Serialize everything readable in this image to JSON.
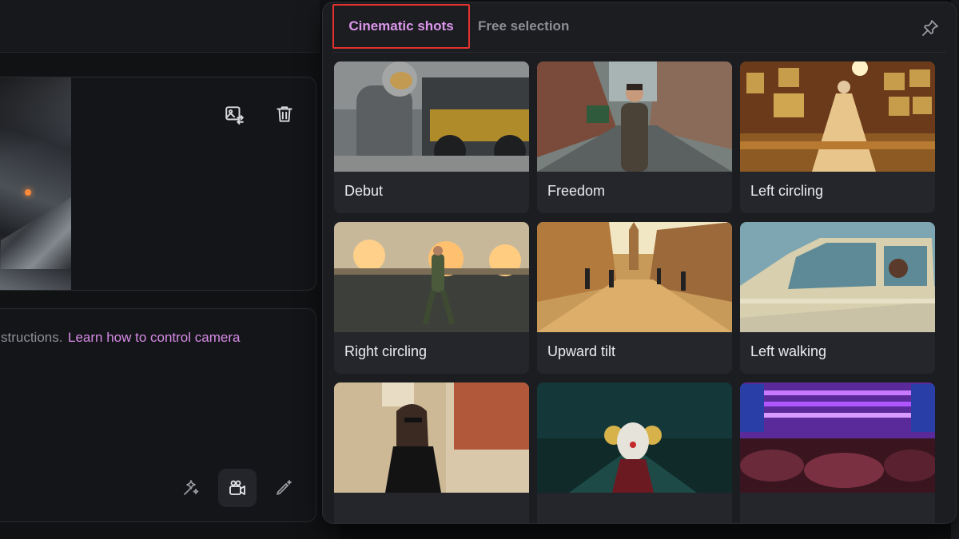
{
  "editor": {
    "prompt_prefix": "structions.",
    "prompt_link": "Learn how to control camera",
    "image_actions": [
      {
        "name": "replace-image-icon"
      },
      {
        "name": "trash-icon"
      }
    ],
    "tools": [
      {
        "name": "magic-wand-icon"
      },
      {
        "name": "camera-video-icon",
        "active": true
      },
      {
        "name": "edit-pen-icon"
      }
    ]
  },
  "camera_panel": {
    "tabs": [
      {
        "label": "Cinematic shots",
        "active": true
      },
      {
        "label": "Free selection",
        "active": false
      }
    ],
    "pin_icon": "pin-icon",
    "presets": [
      {
        "label": "Debut",
        "scene": "astronaut"
      },
      {
        "label": "Freedom",
        "scene": "street"
      },
      {
        "label": "Left circling",
        "scene": "gallery"
      },
      {
        "label": "Right circling",
        "scene": "soldier"
      },
      {
        "label": "Upward tilt",
        "scene": "townsquare"
      },
      {
        "label": "Left walking",
        "scene": "car"
      },
      {
        "label": "",
        "scene": "woman"
      },
      {
        "label": "",
        "scene": "clown"
      },
      {
        "label": "",
        "scene": "concert"
      }
    ]
  },
  "colors": {
    "accent": "#dc97ec",
    "highlight_box": "#e5322e",
    "panel_bg": "#1c1d21",
    "card_bg": "#25262b"
  }
}
